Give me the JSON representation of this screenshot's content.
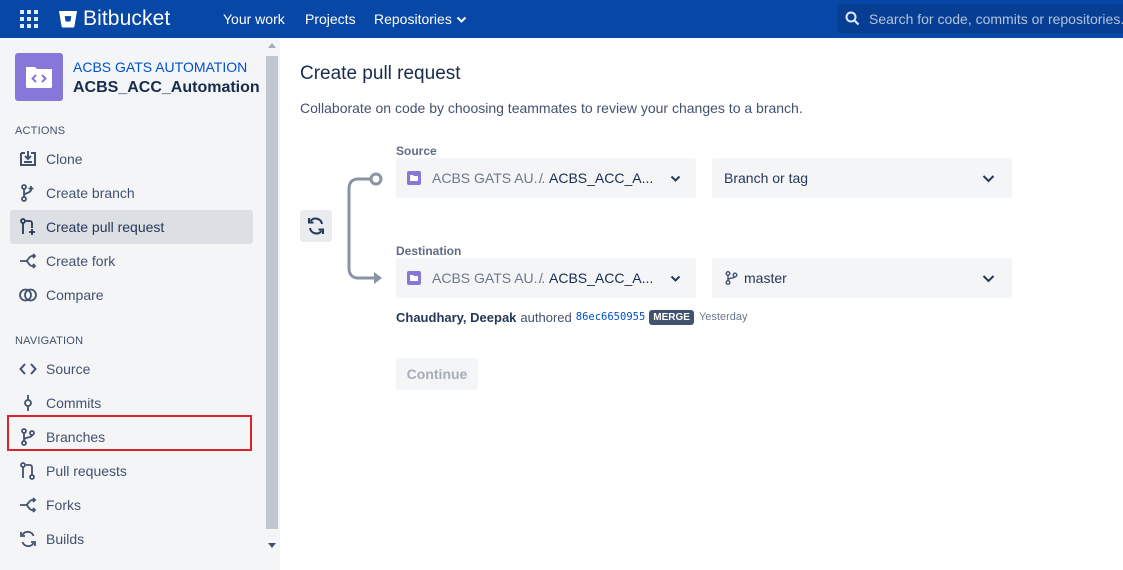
{
  "topnav": {
    "logo_text": "Bitbucket",
    "links": {
      "your_work": "Your work",
      "projects": "Projects",
      "repositories": "Repositories"
    },
    "search_placeholder": "Search for code, commits or repositories..."
  },
  "sidebar": {
    "project_name": "ACBS GATS AUTOMATION",
    "repo_name": "ACBS_ACC_Automation",
    "actions_title": "ACTIONS",
    "actions": {
      "clone": "Clone",
      "create_branch": "Create branch",
      "create_pull_request": "Create pull request",
      "create_fork": "Create fork",
      "compare": "Compare"
    },
    "navigation_title": "NAVIGATION",
    "navigation": {
      "source": "Source",
      "commits": "Commits",
      "branches": "Branches",
      "pull_requests": "Pull requests",
      "forks": "Forks",
      "builds": "Builds"
    },
    "selected_item": "Create pull request",
    "highlighted_item": "Pull requests"
  },
  "main": {
    "title": "Create pull request",
    "description": "Collaborate on code by choosing teammates to review your changes to a branch.",
    "source": {
      "label": "Source",
      "project": "ACBS GATS AU...",
      "separator": "/",
      "repo": "ACBS_ACC_A...",
      "branch_placeholder": "Branch or tag"
    },
    "destination": {
      "label": "Destination",
      "project": "ACBS GATS AU...",
      "separator": "/",
      "repo": "ACBS_ACC_A...",
      "branch": "master"
    },
    "commit": {
      "author": "Chaudhary, Deepak",
      "verb": "authored",
      "hash": "86ec6650955",
      "badge": "MERGE",
      "time": "Yesterday"
    },
    "continue_label": "Continue"
  },
  "colors": {
    "nav_bg": "#0747a6",
    "sidebar_bg": "#f4f5f7",
    "link": "#0052cc",
    "repo_avatar": "#8777d9",
    "highlight": "#d9232e"
  }
}
